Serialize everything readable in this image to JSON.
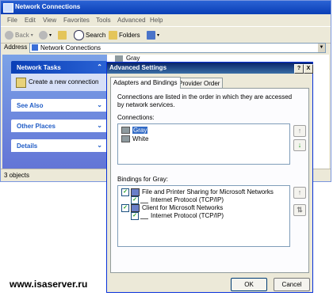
{
  "explorer": {
    "title": "Network Connections",
    "menu": [
      "File",
      "Edit",
      "View",
      "Favorites",
      "Tools",
      "Advanced",
      "Help"
    ],
    "toolbar": {
      "back": "Back",
      "search": "Search",
      "folders": "Folders"
    },
    "address_label": "Address",
    "address_value": "Network Connections",
    "tasks": {
      "network_tasks": "Network Tasks",
      "create_connection": "Create a new connection",
      "see_also": "See Also",
      "other_places": "Other Places",
      "details": "Details"
    },
    "item_gray": "Gray",
    "status": "3 objects"
  },
  "dialog": {
    "title": "Advanced Settings",
    "help": "?",
    "close": "X",
    "tabs": [
      "Adapters and Bindings",
      "Provider Order"
    ],
    "intro": "Connections are listed in the order in which they are accessed by network services.",
    "connections_label": "Connections:",
    "connections": [
      "Gray",
      "White"
    ],
    "bindings_label": "Bindings for Gray:",
    "bindings": [
      {
        "label": "File and Printer Sharing for Microsoft Networks",
        "level": 0,
        "checked": true
      },
      {
        "label": "Internet Protocol (TCP/IP)",
        "level": 1,
        "checked": true
      },
      {
        "label": "Client for Microsoft Networks",
        "level": 0,
        "checked": true
      },
      {
        "label": "Internet Protocol (TCP/IP)",
        "level": 1,
        "checked": true
      }
    ],
    "ok": "OK",
    "cancel": "Cancel"
  },
  "watermark": "www.isaserver.ru",
  "colors": {
    "title_blue": "#0a3fb6",
    "selection": "#316ac5",
    "task_pane": "#7ba2e7"
  }
}
